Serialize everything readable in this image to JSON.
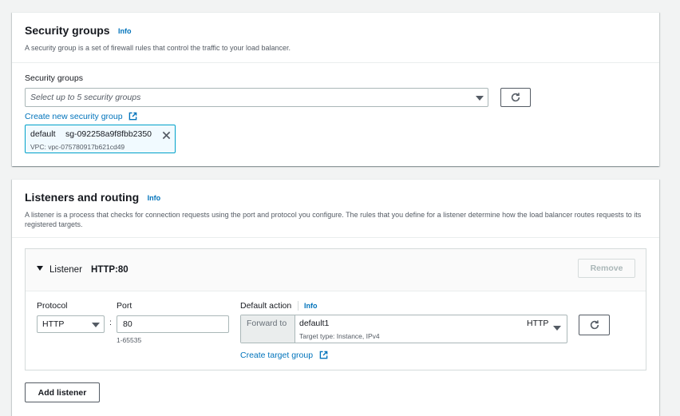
{
  "security_groups": {
    "title": "Security groups",
    "info": "Info",
    "description": "A security group is a set of firewall rules that control the traffic to your load balancer.",
    "field_label": "Security groups",
    "select_placeholder": "Select up to 5 security groups",
    "create_link": "Create new security group",
    "token": {
      "name": "default",
      "id": "sg-092258a9f8fbb2350",
      "vpc": "VPC: vpc-075780917b621cd49"
    }
  },
  "listeners": {
    "title": "Listeners and routing",
    "info": "Info",
    "description": "A listener is a process that checks for connection requests using the port and protocol you configure. The rules that you define for a listener determine how the load balancer routes requests to its registered targets.",
    "listener": {
      "prefix": "Listener",
      "name": "HTTP:80",
      "remove_label": "Remove",
      "protocol_label": "Protocol",
      "protocol_value": "HTTP",
      "separator": ":",
      "port_label": "Port",
      "port_value": "80",
      "port_hint": "1-65535",
      "default_action_label": "Default action",
      "default_action_info": "Info",
      "forward_to": "Forward to",
      "target_group_name": "default1",
      "target_group_desc": "Target type: Instance, IPv4",
      "target_group_protocol": "HTTP",
      "create_target_group": "Create target group"
    },
    "add_listener_label": "Add listener"
  },
  "colors": {
    "link": "#0073bb",
    "token_border": "#00a1c9",
    "token_bg": "#f1faff",
    "background": "#f2f3f3"
  }
}
